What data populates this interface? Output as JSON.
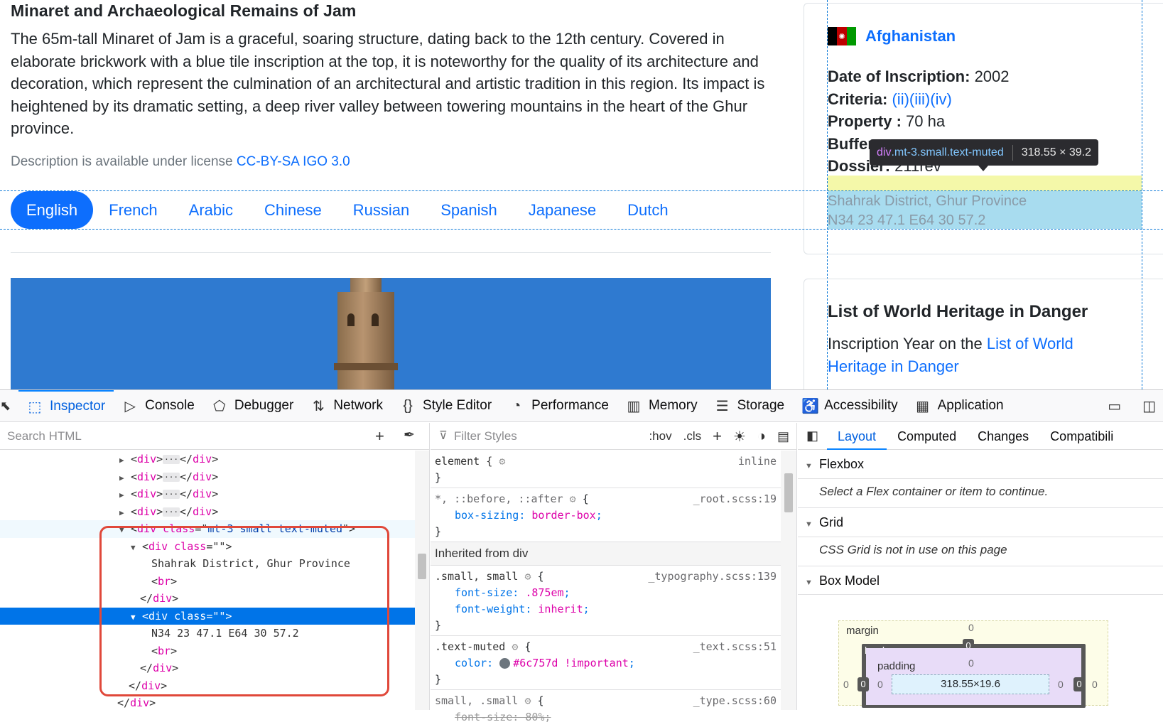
{
  "site": {
    "title": "Minaret and Archaeological Remains of Jam",
    "description": "The 65m-tall Minaret of Jam is a graceful, soaring structure, dating back to the 12th century. Covered in elaborate brickwork with a blue tile inscription at the top, it is noteworthy for the quality of its architecture and decoration, which represent the culmination of an architectural and artistic tradition in this region. Its impact is heightened by its dramatic setting, a deep river valley between towering mountains in the heart of the Ghur province.",
    "license_prefix": "Description is available under license ",
    "license_link": "CC-BY-SA IGO 3.0",
    "languages": [
      "English",
      "French",
      "Arabic",
      "Chinese",
      "Russian",
      "Spanish",
      "Japanese",
      "Dutch"
    ],
    "active_language": "English"
  },
  "sidebar": {
    "country": "Afghanistan",
    "facts": {
      "date_label": "Date of Inscription:",
      "date_value": " 2002",
      "criteria_label": "Criteria:",
      "criteria_values": [
        "(ii)",
        "(iii)",
        "(iv)"
      ],
      "property_label": "Property :",
      "property_value": " 70 ha",
      "buffer_label": "Buffer",
      "dossier_label": "Dossier:",
      "dossier_value": " 211rev"
    },
    "location_line1": "Shahrak District, Ghur Province",
    "location_line2": "N34 23 47.1 E64 30 57.2",
    "danger_title": "List of World Heritage in Danger",
    "danger_text_prefix": "Inscription Year on the ",
    "danger_link": "List of World Heritage in Danger"
  },
  "highlighter": {
    "tooltip_element": "div",
    "tooltip_classes": ".mt-3.small.text-muted",
    "tooltip_size": "318.55 × 39.2"
  },
  "devtools": {
    "tabs": [
      {
        "label": "Inspector",
        "icon": "inspector-icon",
        "glyph": "⬚"
      },
      {
        "label": "Console",
        "icon": "console-icon",
        "glyph": "▷"
      },
      {
        "label": "Debugger",
        "icon": "debugger-icon",
        "glyph": "⬠"
      },
      {
        "label": "Network",
        "icon": "network-icon",
        "glyph": "⇅"
      },
      {
        "label": "Style Editor",
        "icon": "style-editor-icon",
        "glyph": "{}"
      },
      {
        "label": "Performance",
        "icon": "performance-icon",
        "glyph": "◔"
      },
      {
        "label": "Memory",
        "icon": "memory-icon",
        "glyph": "▥"
      },
      {
        "label": "Storage",
        "icon": "storage-icon",
        "glyph": "☰"
      },
      {
        "label": "Accessibility",
        "icon": "accessibility-icon",
        "glyph": "♿"
      },
      {
        "label": "Application",
        "icon": "application-icon",
        "glyph": "▦"
      }
    ],
    "active_tab": "Inspector",
    "search_placeholder": "Search HTML",
    "markup": {
      "collapsed_div": "div",
      "outer_class": "mt-3 small text-muted",
      "inner_class": "",
      "text_line1": "Shahrak District, Ghur Province",
      "text_line2": "N34 23 47.1 E64 30 57.2",
      "br": "br"
    },
    "rules": {
      "filter_placeholder": "Filter Styles",
      "hov": ":hov",
      "cls": ".cls",
      "element_selector": "element {",
      "element_src": "inline",
      "universal_selector": "*, ::before, ::after",
      "universal_src": "_root.scss:19",
      "universal_prop": "box-sizing",
      "universal_val": "border-box",
      "inherited_label": "Inherited from div",
      "small_selector": ".small, small",
      "small_src": "_typography.scss:139",
      "small_prop1": "font-size",
      "small_val1": ".875em",
      "small_prop2": "font-weight",
      "small_val2": "inherit",
      "muted_selector": ".text-muted",
      "muted_src": "_text.scss:51",
      "muted_prop": "color",
      "muted_val": "#6c757d !important",
      "small2_selector": "small, .small",
      "small2_src": "_type.scss:60",
      "small2_prop": "font-size: 80%;"
    },
    "layout": {
      "tabs": [
        "Layout",
        "Computed",
        "Changes",
        "Compatibili"
      ],
      "active_tab": "Layout",
      "flexbox_title": "Flexbox",
      "flexbox_msg": "Select a Flex container or item to continue.",
      "grid_title": "Grid",
      "grid_msg": "CSS Grid is not in use on this page",
      "boxmodel_title": "Box Model",
      "margin_label": "margin",
      "border_label": "border",
      "padding_label": "padding",
      "content_size": "318.55×19.6",
      "zero": "0"
    }
  },
  "colors": {
    "link": "#0d6efd",
    "muted": "#6c757d",
    "selection": "#0074e8",
    "annotation": "#e0483a"
  }
}
